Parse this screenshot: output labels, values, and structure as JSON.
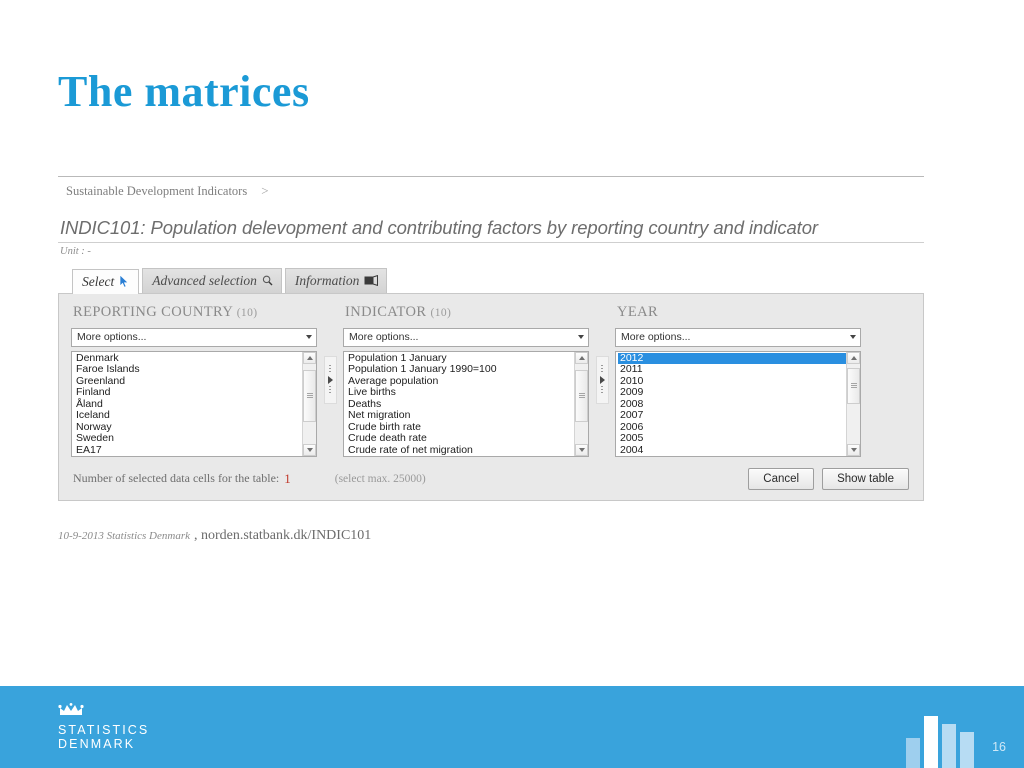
{
  "slide": {
    "title": "The matrices",
    "page_number": "16",
    "accent_color": "#1b9ad6",
    "footer_color": "#39a3dc"
  },
  "breadcrumb": {
    "item": "Sustainable Development Indicators",
    "separator": ">"
  },
  "matrix": {
    "title": "INDIC101: Population delevopment and contributing factors by reporting country and indicator",
    "unit": "Unit : -"
  },
  "tabs": [
    {
      "label": "Select",
      "icon": "cursor-arrow-icon",
      "active": true
    },
    {
      "label": "Advanced selection",
      "icon": "magnifier-icon",
      "active": false
    },
    {
      "label": "Information",
      "icon": "info-card-icon",
      "active": false
    }
  ],
  "columns": [
    {
      "id": "reporting-country",
      "heading": "REPORTING COUNTRY",
      "count": "(10)",
      "combo_value": "More options...",
      "items": [
        "Denmark",
        "Faroe Islands",
        "Greenland",
        "Finland",
        "Åland",
        "Iceland",
        "Norway",
        "Sweden",
        "EA17"
      ],
      "selected": []
    },
    {
      "id": "indicator",
      "heading": "INDICATOR",
      "count": "(10)",
      "combo_value": "More options...",
      "items": [
        "Population 1 January",
        "Population 1 January 1990=100",
        "Average population",
        "Live births",
        "Deaths",
        "Net migration",
        "Crude birth rate",
        "Crude death rate",
        "Crude rate of net migration"
      ],
      "selected": []
    },
    {
      "id": "year",
      "heading": "YEAR",
      "count": "",
      "combo_value": "More options...",
      "items": [
        "2012",
        "2011",
        "2010",
        "2009",
        "2008",
        "2007",
        "2006",
        "2005",
        "2004"
      ],
      "selected": [
        "2012"
      ]
    }
  ],
  "footer_bar": {
    "cells_label": "Number of selected data cells for the table:",
    "cells_value": "1",
    "max_note": "(select max. 25000)",
    "cancel_label": "Cancel",
    "show_table_label": "Show table"
  },
  "source": {
    "date": "10-9-2013 Statistics Denmark",
    "url": ", norden.statbank.dk/INDIC101"
  },
  "brand": {
    "line1": "STATISTICS",
    "line2": "DENMARK"
  }
}
